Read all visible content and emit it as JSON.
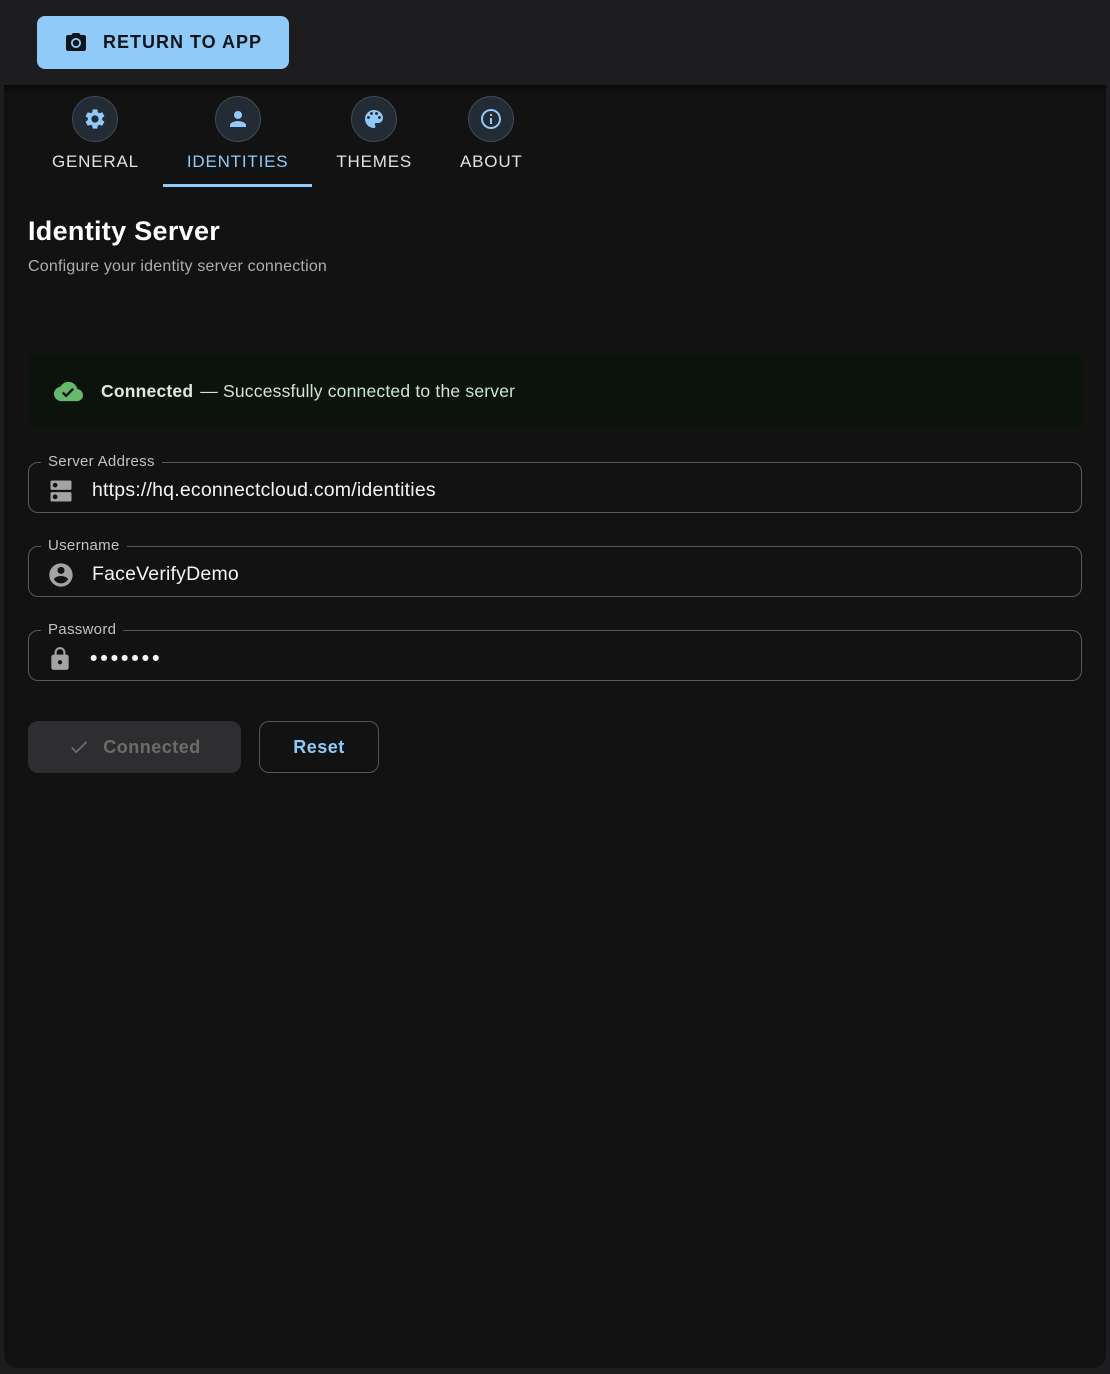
{
  "header": {
    "return_button": {
      "label": "RETURN TO APP",
      "icon": "camera-icon"
    }
  },
  "tabs": [
    {
      "label": "GENERAL",
      "icon": "gear-icon",
      "active": false
    },
    {
      "label": "IDENTITIES",
      "icon": "person-icon",
      "active": true
    },
    {
      "label": "THEMES",
      "icon": "palette-icon",
      "active": false
    },
    {
      "label": "ABOUT",
      "icon": "info-icon",
      "active": false
    }
  ],
  "page": {
    "title": "Identity Server",
    "subtitle": "Configure your identity server connection"
  },
  "status_banner": {
    "icon": "cloud-done-icon",
    "state": "Connected",
    "message": "— Successfully connected to the server"
  },
  "form": {
    "server_address": {
      "label": "Server Address",
      "value": "https://hq.econnectcloud.com/identities",
      "icon": "server-icon"
    },
    "username": {
      "label": "Username",
      "value": "FaceVerifyDemo",
      "icon": "account-icon"
    },
    "password": {
      "label": "Password",
      "value": "•••••••",
      "masked": true,
      "icon": "lock-icon"
    }
  },
  "actions": {
    "connect_button": {
      "label": "Connected",
      "disabled": true,
      "icon": "check-icon"
    },
    "reset_button": {
      "label": "Reset"
    }
  },
  "colors": {
    "accent": "#90caf9",
    "success_icon": "#66bb6a",
    "alert_bg": "#0c130d",
    "alert_text": "#cce8cd",
    "card_bg": "#121213",
    "window_bg": "#1d1d1f"
  }
}
